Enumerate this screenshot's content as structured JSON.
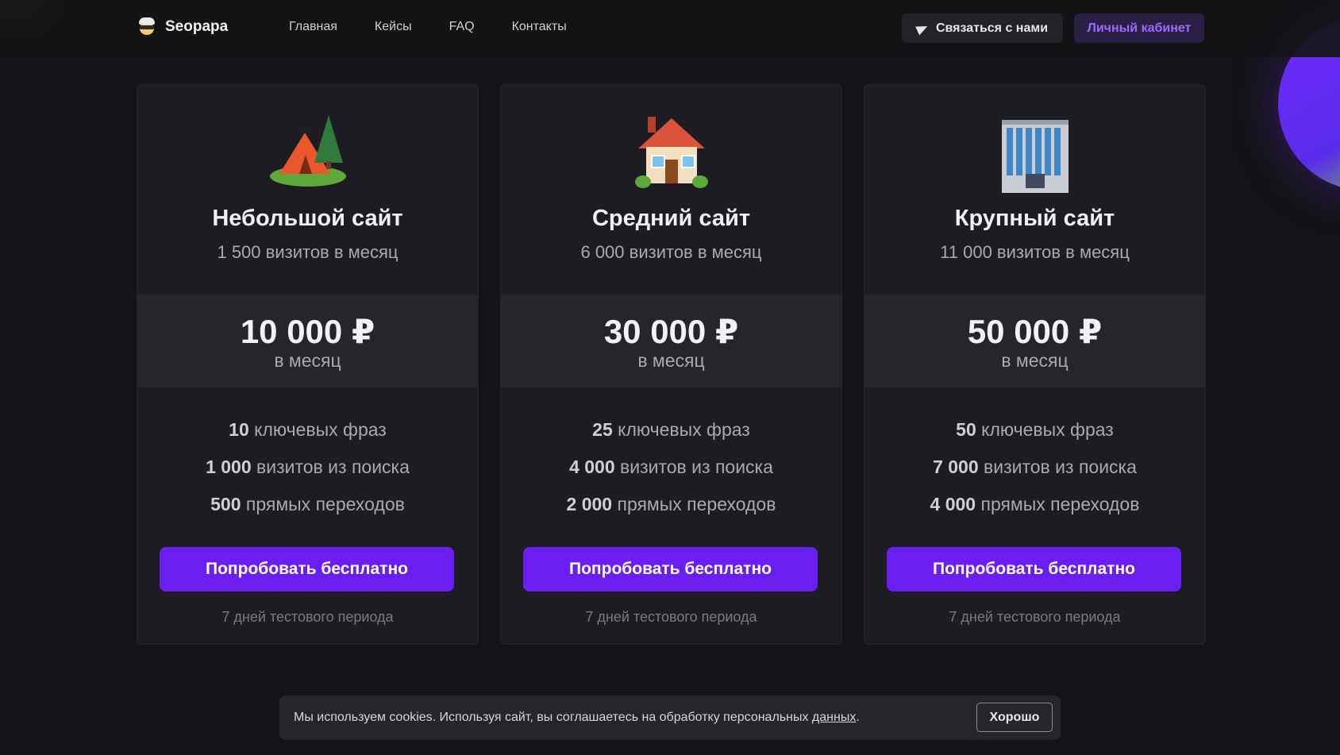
{
  "header": {
    "logo_text": "Seopapa",
    "nav": [
      "Главная",
      "Кейсы",
      "FAQ",
      "Контакты"
    ],
    "contact_label": "Связаться с нами",
    "cabinet_label": "Личный кабинет"
  },
  "plans": [
    {
      "icon": "tent-icon",
      "title": "Небольшой сайт",
      "visits": "1 500 визитов в месяц",
      "price": "10 000 ₽",
      "period": "в месяц",
      "features": [
        {
          "value": "10",
          "text": "ключевых фраз"
        },
        {
          "value": "1 000",
          "text": "визитов из поиска"
        },
        {
          "value": "500",
          "text": "прямых переходов"
        }
      ],
      "button": "Попробовать бесплатно",
      "trial": "7 дней тестового периода"
    },
    {
      "icon": "house-icon",
      "title": "Средний сайт",
      "visits": "6 000 визитов в месяц",
      "price": "30 000 ₽",
      "period": "в месяц",
      "features": [
        {
          "value": "25",
          "text": "ключевых фраз"
        },
        {
          "value": "4 000",
          "text": "визитов из поиска"
        },
        {
          "value": "2 000",
          "text": "прямых переходов"
        }
      ],
      "button": "Попробовать бесплатно",
      "trial": "7 дней тестового периода"
    },
    {
      "icon": "office-building-icon",
      "title": "Крупный сайт",
      "visits": "11 000 визитов в месяц",
      "price": "50 000 ₽",
      "period": "в месяц",
      "features": [
        {
          "value": "50",
          "text": "ключевых фраз"
        },
        {
          "value": "7 000",
          "text": "визитов из поиска"
        },
        {
          "value": "4 000",
          "text": "прямых переходов"
        }
      ],
      "button": "Попробовать бесплатно",
      "trial": "7 дней тестового периода"
    }
  ],
  "cookie": {
    "text": "Мы используем cookies. Используя сайт, вы соглашаетесь на обработку персональных ",
    "link": "данных",
    "end": ".",
    "ok": "Хорошо"
  },
  "colors": {
    "background": "#141317",
    "card": "#1d1c22",
    "accent": "#6a1ff0",
    "cabinet_text": "#9a6bff"
  }
}
